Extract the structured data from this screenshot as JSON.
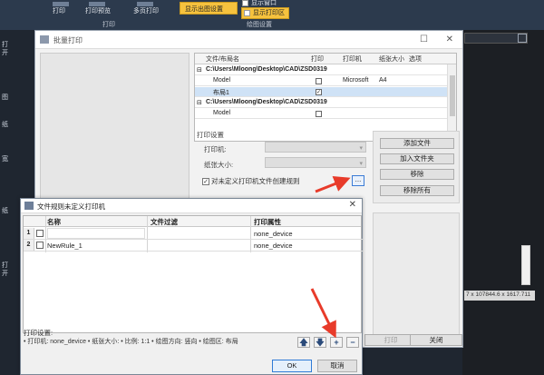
{
  "ribbon": {
    "buttons": [
      "打印",
      "打印预览",
      "多页打印"
    ],
    "group_print": "打印",
    "highlight": "显示出图设置",
    "checks": [
      "显示窗口",
      "显示打印区"
    ],
    "group_draw": "绘图设置"
  },
  "left_strip": [
    "打开",
    "图",
    "纸",
    "宽",
    "纸",
    "打开"
  ],
  "batch_window": {
    "title": "批量打印",
    "table": {
      "headers": [
        "文件/布局名",
        "打印",
        "打印机",
        "纸张大小",
        "选项"
      ],
      "rows": [
        {
          "type": "file",
          "name": "C:\\Users\\Mloong\\Desktop\\CAD\\ZSD0319"
        },
        {
          "type": "layout",
          "name": "Model",
          "print": false,
          "printer": "Microsoft",
          "paper": "A4"
        },
        {
          "type": "layout",
          "name": "布局1",
          "print": true,
          "selected": true
        },
        {
          "type": "file",
          "name": "C:\\Users\\Mloong\\Desktop\\CAD\\ZSD0319"
        },
        {
          "type": "layout",
          "name": "Model",
          "print": false
        }
      ]
    },
    "settings": {
      "heading": "打印设置",
      "printer_label": "打印机:",
      "paper_label": "纸张大小:",
      "rule_check_label": "对未定义打印机文件创建规则",
      "dots": "..."
    },
    "side_buttons": [
      "添加文件",
      "加入文件夹",
      "移除",
      "移除所有"
    ],
    "bottom_buttons": {
      "print": "打印",
      "close": "关闭"
    }
  },
  "rule_dialog": {
    "title": "文件规则未定义打印机",
    "headers": [
      "名称",
      "文件过滤",
      "打印属性"
    ],
    "rows": [
      {
        "num": "1",
        "name": "",
        "filter": "",
        "prop": "none_device"
      },
      {
        "num": "2",
        "name": "NewRule_1",
        "filter": "",
        "prop": "none_device"
      }
    ],
    "footer_heading": "打印设置:",
    "footer_detail": "• 打印机: none_device • 纸张大小: • 比例: 1:1 • 绘图方向: 竖向 • 绘图区: 布局",
    "ok": "OK",
    "cancel": "取消"
  },
  "status": {
    "coords": "7 x 107844.6 x 1617.711"
  },
  "colors": {
    "highlight": "#f6c23e",
    "arrow": "#e83b2a",
    "selection": "#cfe2f6"
  }
}
